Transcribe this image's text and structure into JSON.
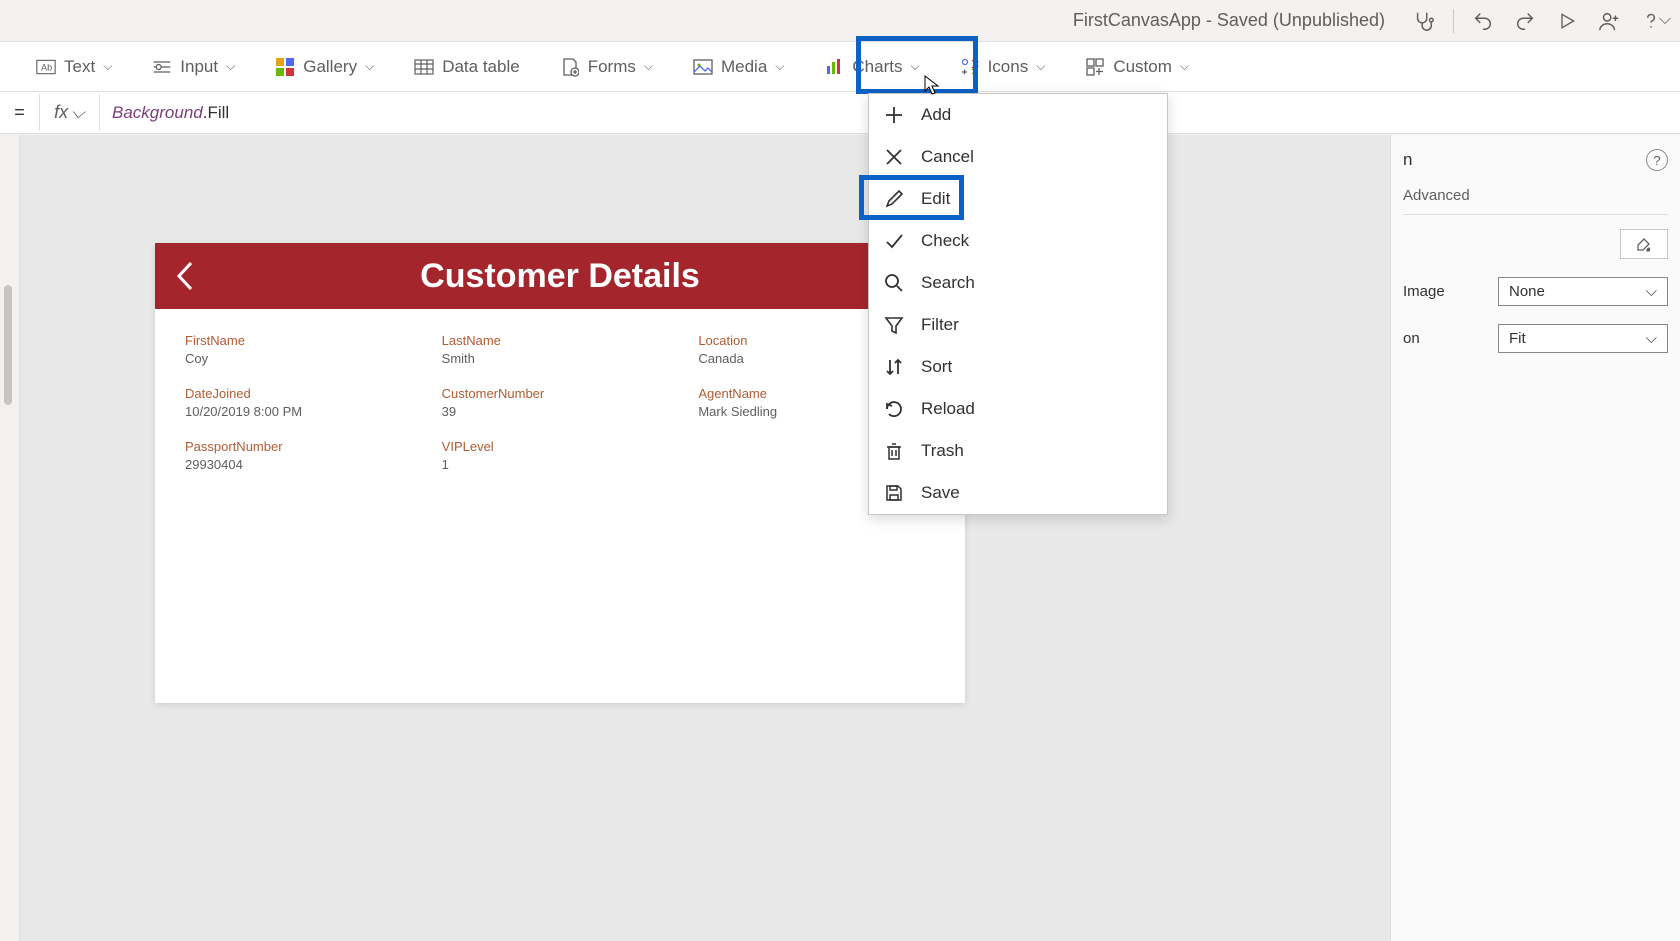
{
  "titlebar": {
    "app_title": "FirstCanvasApp - Saved (Unpublished)"
  },
  "ribbon": {
    "text": "Text",
    "input": "Input",
    "gallery": "Gallery",
    "data_table": "Data table",
    "forms": "Forms",
    "media": "Media",
    "charts": "Charts",
    "icons": "Icons",
    "custom": "Custom"
  },
  "formula": {
    "eq": "=",
    "fx": "fx",
    "token1": "Background",
    "token2": ".Fill"
  },
  "canvas": {
    "header_title": "Customer Details",
    "fields": {
      "firstname_label": "FirstName",
      "firstname_value": "Coy",
      "lastname_label": "LastName",
      "lastname_value": "Smith",
      "location_label": "Location",
      "location_value": "Canada",
      "datejoined_label": "DateJoined",
      "datejoined_value": "10/20/2019 8:00 PM",
      "customernumber_label": "CustomerNumber",
      "customernumber_value": "39",
      "agentname_label": "AgentName",
      "agentname_value": "Mark Siedling",
      "passport_label": "PassportNumber",
      "passport_value": "29930404",
      "vip_label": "VIPLevel",
      "vip_value": "1"
    }
  },
  "right_panel": {
    "title_suffix": "n",
    "tab_advanced": "Advanced",
    "prop_image_label": "Image",
    "prop_image_value": "None",
    "prop_position_label": "on",
    "prop_position_value": "Fit"
  },
  "icons_menu": {
    "items": [
      {
        "icon": "add-icon",
        "label": "Add"
      },
      {
        "icon": "cancel-icon",
        "label": "Cancel"
      },
      {
        "icon": "edit-icon",
        "label": "Edit"
      },
      {
        "icon": "check-icon",
        "label": "Check"
      },
      {
        "icon": "search-icon",
        "label": "Search"
      },
      {
        "icon": "filter-icon",
        "label": "Filter"
      },
      {
        "icon": "sort-icon",
        "label": "Sort"
      },
      {
        "icon": "reload-icon",
        "label": "Reload"
      },
      {
        "icon": "trash-icon",
        "label": "Trash"
      },
      {
        "icon": "save-icon",
        "label": "Save"
      }
    ]
  }
}
